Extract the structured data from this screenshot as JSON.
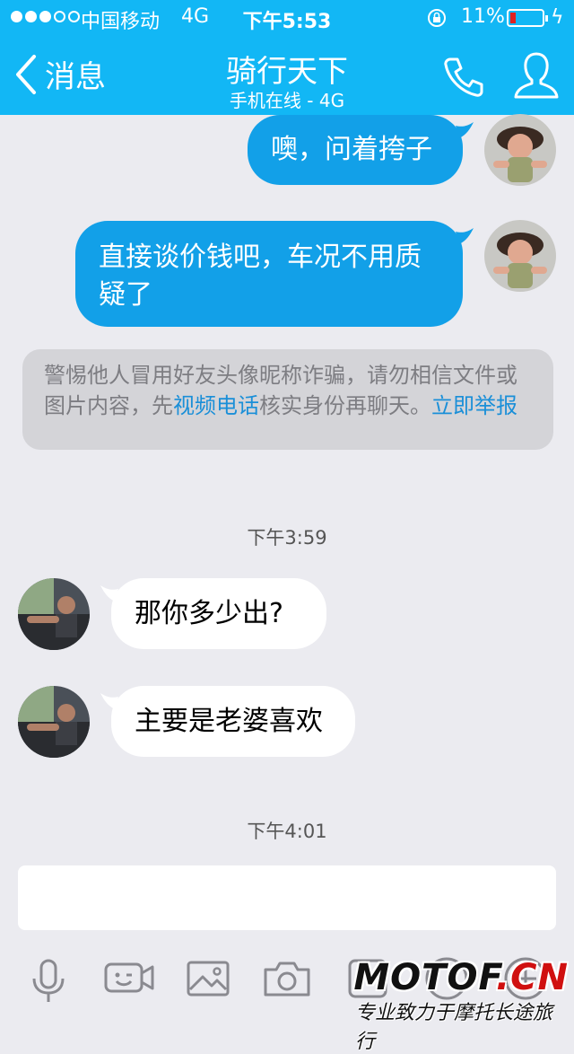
{
  "status_bar": {
    "carrier": "中国移动",
    "network": "4G",
    "time": "下午5:53",
    "battery_percent": "11%"
  },
  "nav": {
    "back_label": "消息",
    "title": "骑行天下",
    "subtitle": "手机在线 - 4G"
  },
  "messages": [
    {
      "direction": "out",
      "text": "噢，问着挎子"
    },
    {
      "direction": "out",
      "text": "直接谈价钱吧，车况不用质疑了"
    },
    {
      "direction": "in",
      "text": "那你多少出?"
    },
    {
      "direction": "in",
      "text": "主要是老婆喜欢"
    }
  ],
  "notice": {
    "text_before": "警惕他人冒用好友头像昵称诈骗，请勿相信文件或图片内容，先",
    "video_call_link": "视频电话",
    "text_after": "核实身份再聊天。",
    "report_link": "立即举报"
  },
  "timestamps": [
    "下午3:59",
    "下午4:01"
  ],
  "input": {
    "value": ""
  },
  "toolbar": [
    "microphone-icon",
    "video-emoji-icon",
    "image-icon",
    "camera-icon",
    "file-icon",
    "emoji-icon",
    "plus-icon"
  ],
  "watermark": {
    "main": "MOTOF",
    "suffix": ".CN",
    "sub": "专业致力于摩托长途旅行"
  },
  "colors": {
    "accent": "#12b7f5",
    "bubble_out": "#12a0e8",
    "link": "#1a8fd8"
  }
}
